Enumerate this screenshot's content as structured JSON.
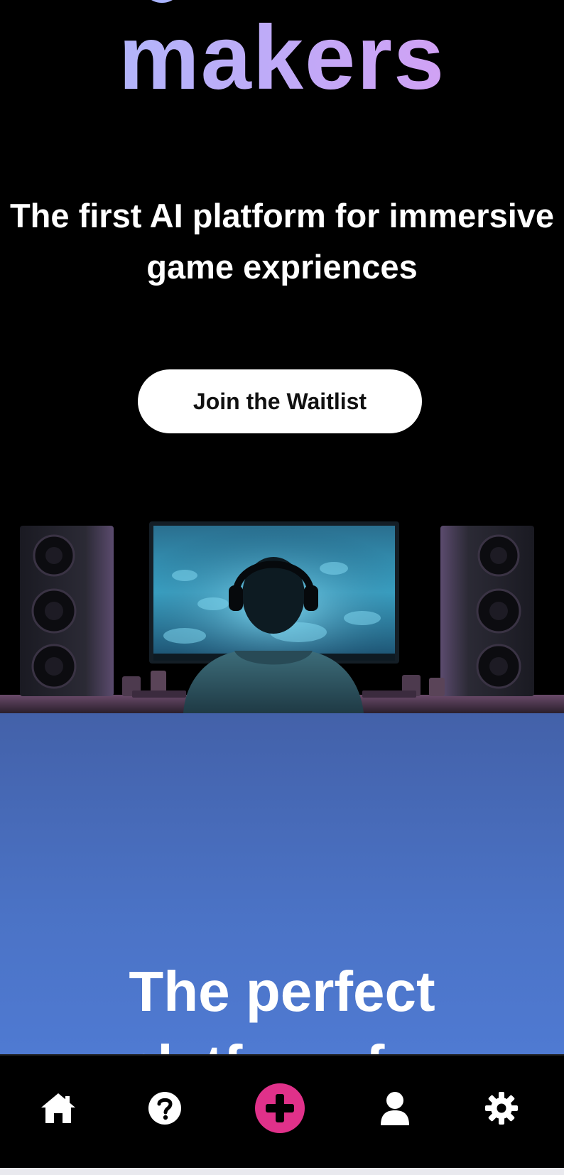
{
  "hero": {
    "headline_word": "makers",
    "subtitle": "The first AI platform for immersive\ngame expriences",
    "cta_label": "Join the Waitlist"
  },
  "section": {
    "title": "The perfect\nplatform for"
  },
  "bottom_nav": {
    "items": [
      {
        "icon": "home-icon"
      },
      {
        "icon": "help-circle-icon"
      },
      {
        "icon": "plus-circle-icon",
        "accent": "#e0318a"
      },
      {
        "icon": "user-icon"
      },
      {
        "icon": "gear-icon"
      }
    ]
  },
  "colors": {
    "background": "#000000",
    "headline_gradient_start": "#a9bdfc",
    "headline_gradient_end": "#de9cf2",
    "section_blue": "#4b73c6",
    "accent_pink": "#e0318a"
  }
}
